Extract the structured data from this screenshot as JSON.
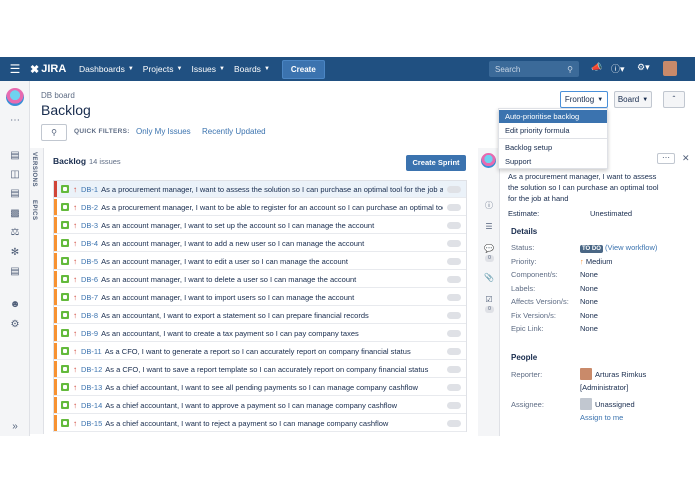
{
  "topnav": {
    "logo": "JIRA",
    "items": [
      "Dashboards",
      "Projects",
      "Issues",
      "Boards"
    ],
    "create": "Create",
    "search_placeholder": "Search"
  },
  "header": {
    "breadcrumb": "DB board",
    "title": "Backlog",
    "quick_filters_label": "QUICK FILTERS:",
    "quick_filters": [
      "Only My Issues",
      "Recently Updated"
    ],
    "frontlog_btn": "Frontlog",
    "board_btn": "Board"
  },
  "dropdown": {
    "items": [
      "Auto-prioritise backlog",
      "Edit priority formula",
      "Backlog setup",
      "Support"
    ]
  },
  "vtabs": [
    "VERSIONS",
    "EPICS"
  ],
  "backlog": {
    "title": "Backlog",
    "count": "14 issues",
    "create_sprint": "Create Sprint",
    "issues": [
      {
        "key": "DB-1",
        "summary": "As a procurement manager, I want to assess the solution so I can purchase an optimal tool for the job at hand"
      },
      {
        "key": "DB-2",
        "summary": "As a procurement manager, I want to be able to register for an account so I can purchase an optimal tool"
      },
      {
        "key": "DB-3",
        "summary": "As an account manager, I want to set up the account so I can manage the account"
      },
      {
        "key": "DB-4",
        "summary": "As an account manager, I want to add a new user so I can manage the account"
      },
      {
        "key": "DB-5",
        "summary": "As an account manager, I want to edit a user so I can manage the account"
      },
      {
        "key": "DB-6",
        "summary": "As an account manager, I want to delete a user so I can manage the account"
      },
      {
        "key": "DB-7",
        "summary": "As an account manager, I want to import users so I can manage the account"
      },
      {
        "key": "DB-8",
        "summary": "As an accountant, I want to export a statement so I can prepare financial records"
      },
      {
        "key": "DB-9",
        "summary": "As an accountant, I want to create a tax payment so I can pay company taxes"
      },
      {
        "key": "DB-11",
        "summary": "As a CFO, I want to generate a report so I can accurately report on company financial status"
      },
      {
        "key": "DB-12",
        "summary": "As a CFO, I want to save a report template so I can accurately report on company financial status"
      },
      {
        "key": "DB-13",
        "summary": "As a chief accountant, I want to see all pending payments so I can manage company cashflow"
      },
      {
        "key": "DB-14",
        "summary": "As a chief accountant, I want to approve a payment so I can manage company cashflow"
      },
      {
        "key": "DB-15",
        "summary": "As a chief accountant, I want to reject a payment so I can manage company cashflow"
      }
    ]
  },
  "detail": {
    "summary_lines": [
      "As a procurement manager, I want to assess",
      "the solution so I can purchase an optimal tool",
      "for the job at hand"
    ],
    "estimate_label": "Estimate:",
    "estimate_value": "Unestimated",
    "details_heading": "Details",
    "status_label": "Status:",
    "status_value": "TO DO",
    "view_workflow": "(View workflow)",
    "priority_label": "Priority:",
    "priority_value": "Medium",
    "components_label": "Component/s:",
    "components_value": "None",
    "labels_label": "Labels:",
    "labels_value": "None",
    "affects_label": "Affects Version/s:",
    "affects_value": "None",
    "fix_label": "Fix Version/s:",
    "fix_value": "None",
    "epic_label": "Epic Link:",
    "epic_value": "None",
    "people_heading": "People",
    "reporter_label": "Reporter:",
    "reporter_name": "Arturas Rimkus",
    "reporter_role": "[Administrator]",
    "assignee_label": "Assignee:",
    "assignee_value": "Unassigned",
    "assign_to_me": "Assign to me",
    "badges": [
      "0",
      "0"
    ]
  },
  "colors": {
    "nav": "#205081",
    "accent": "#3b73af",
    "story": "#63ba3c",
    "priority_high": "#d04437",
    "rank_bar": "#f79232"
  }
}
